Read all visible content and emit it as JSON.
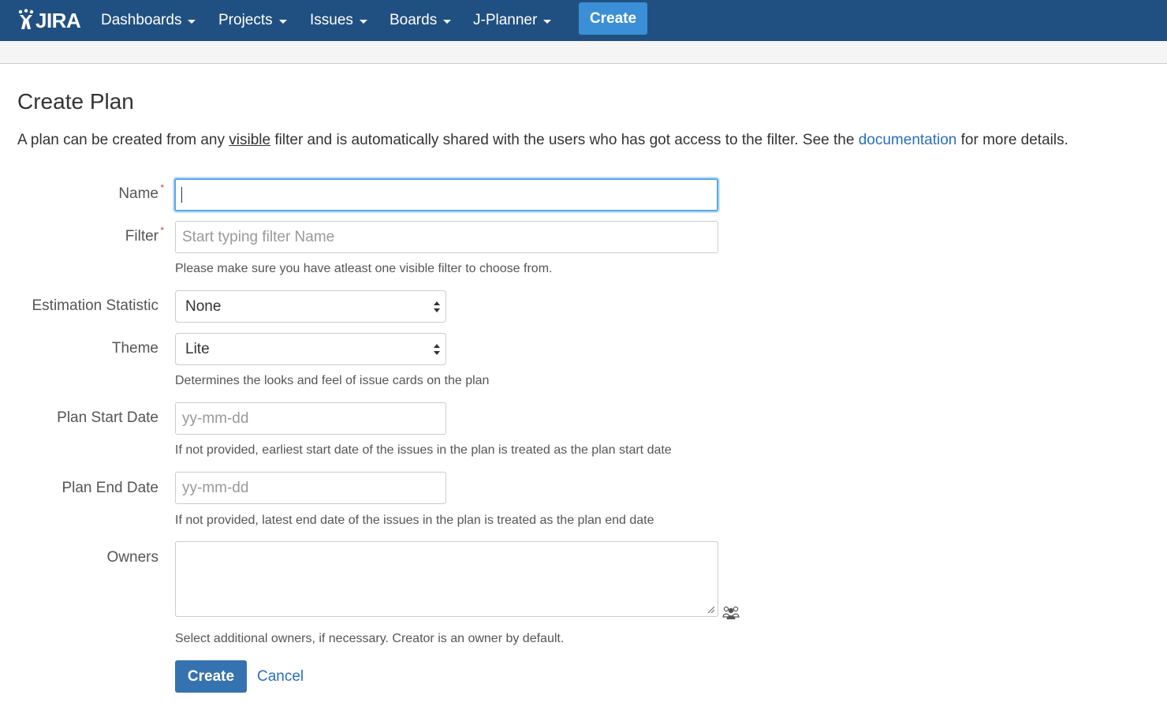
{
  "nav": {
    "logo": "JIRA",
    "items": [
      {
        "label": "Dashboards"
      },
      {
        "label": "Projects"
      },
      {
        "label": "Issues"
      },
      {
        "label": "Boards"
      },
      {
        "label": "J-Planner"
      }
    ],
    "create_label": "Create"
  },
  "page": {
    "title": "Create Plan",
    "intro_prefix": "A plan can be created from any ",
    "intro_underlined": "visible",
    "intro_middle": " filter and is automatically shared with the users who has got access to the filter. See the ",
    "intro_link": "documentation",
    "intro_suffix": " for more details."
  },
  "form": {
    "name": {
      "label": "Name",
      "required_mark": "*",
      "value": ""
    },
    "filter": {
      "label": "Filter",
      "required_mark": "*",
      "placeholder": "Start typing filter Name",
      "help": "Please make sure you have atleast one visible filter to choose from."
    },
    "estimation": {
      "label": "Estimation Statistic",
      "selected": "None"
    },
    "theme": {
      "label": "Theme",
      "selected": "Lite",
      "help": "Determines the looks and feel of issue cards on the plan"
    },
    "start_date": {
      "label": "Plan Start Date",
      "placeholder": "yy-mm-dd",
      "help": "If not provided, earliest start date of the issues in the plan is treated as the plan start date"
    },
    "end_date": {
      "label": "Plan End Date",
      "placeholder": "yy-mm-dd",
      "help": "If not provided, latest end date of the issues in the plan is treated as the plan end date"
    },
    "owners": {
      "label": "Owners",
      "icon": "user-picker-icon",
      "help": "Select additional owners, if necessary. Creator is an owner by default."
    },
    "submit_label": "Create",
    "cancel_label": "Cancel"
  },
  "colors": {
    "nav_bg": "#205081",
    "nav_create_bg": "#3b8fd6",
    "primary_button": "#3572b0",
    "link": "#2a6ebb",
    "required": "#d04437",
    "focus": "#5aa6e8"
  }
}
